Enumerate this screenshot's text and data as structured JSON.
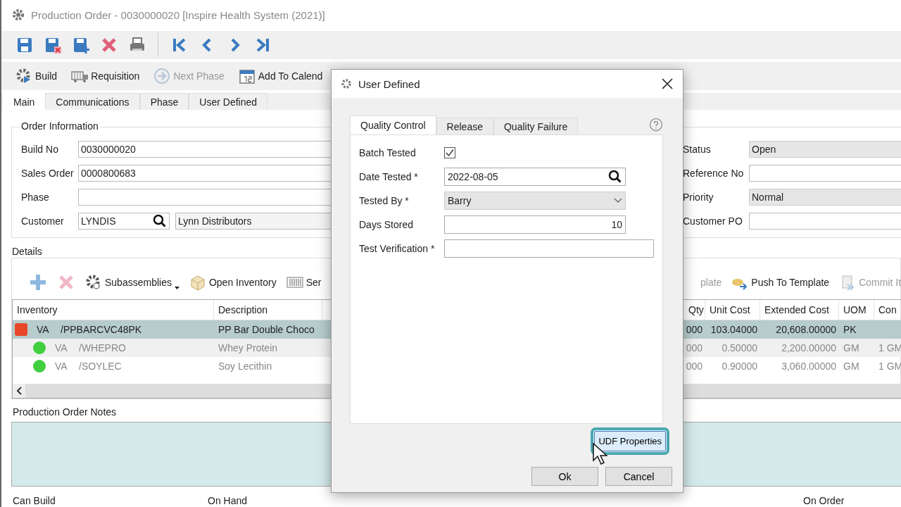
{
  "window": {
    "title": "Production Order - 0030000020 [Inspire Health System (2021)]"
  },
  "action_bar": [
    {
      "label": "Build",
      "disabled": false
    },
    {
      "label": "Requisition",
      "disabled": false
    },
    {
      "label": "Next Phase",
      "disabled": true
    },
    {
      "label": "Add To Calend",
      "disabled": false
    }
  ],
  "tabs": [
    {
      "label": "Main",
      "selected": true
    },
    {
      "label": "Communications",
      "selected": false
    },
    {
      "label": "Phase",
      "selected": false
    },
    {
      "label": "User Defined",
      "selected": false
    }
  ],
  "order_information": {
    "title": "Order Information",
    "left_fields": [
      {
        "kind": "text",
        "label": "Build No",
        "value": "0030000020"
      },
      {
        "kind": "text",
        "label": "Sales Order",
        "value": "0000800683"
      },
      {
        "kind": "text",
        "label": "Phase"
      },
      {
        "kind": "lookup",
        "label": "Customer",
        "value": "LYNDIS",
        "description": "Lynn Distributors"
      }
    ],
    "right_fields": [
      {
        "label": "Status",
        "value": "Open",
        "readonly": true
      },
      {
        "label": "Reference No",
        "readonly": false
      },
      {
        "label": "Priority",
        "value": "Normal",
        "readonly": true
      },
      {
        "label": "Customer PO",
        "readonly": false
      }
    ]
  },
  "details": {
    "title": "Details",
    "toolbar_left": [
      {
        "label": "Subassemblies",
        "disabled": false
      },
      {
        "label": "Open Inventory",
        "disabled": false
      },
      {
        "label": "Ser",
        "disabled": false
      }
    ],
    "toolbar_right": [
      {
        "label": "plate",
        "disabled": true
      },
      {
        "label": "Push To Template",
        "disabled": false
      },
      {
        "label": "Commit It",
        "disabled": true
      }
    ],
    "columns_left": [
      "Inventory",
      "Description"
    ],
    "columns_right": [
      "Qty",
      "Unit Cost",
      "Extended Cost",
      "UOM",
      "Con"
    ],
    "rows": [
      {
        "kind": "assembly",
        "selected": true,
        "location": "VA",
        "inventory": "/PPBARCVC48PK",
        "description": "PP Bar Double Choco",
        "qty": "000",
        "unit_cost": "103.04000",
        "extended_cost": "20,608.00000",
        "uom": "PK"
      },
      {
        "kind": "component",
        "selected": false,
        "location": "VA",
        "inventory": "/WHEPRO",
        "description": "Whey Protein",
        "qty": "000",
        "unit_cost": "0.50000",
        "extended_cost": "2,200.00000",
        "uom": "GM",
        "conv": "1 GM"
      },
      {
        "kind": "component",
        "selected": false,
        "location": "VA",
        "inventory": "/SOYLEC",
        "description": "Soy Lecithin",
        "qty": "000",
        "unit_cost": "0.90000",
        "extended_cost": "3,060.00000",
        "uom": "GM",
        "conv": "1 GM"
      }
    ]
  },
  "notes": {
    "label": "Production Order Notes"
  },
  "totals_left": [
    "Can Build",
    "On Hand"
  ],
  "totals_right": [
    "On Order"
  ],
  "dialog": {
    "title": "User Defined",
    "tabs": [
      {
        "label": "Quality Control",
        "selected": true
      },
      {
        "label": "Release",
        "selected": false
      },
      {
        "label": "Quality Failure",
        "selected": false
      }
    ],
    "fields": [
      {
        "kind": "checkbox",
        "label": "Batch Tested",
        "checked": true
      },
      {
        "kind": "lookup",
        "label": "Date Tested *",
        "value": "2022-08-05"
      },
      {
        "kind": "dropdown",
        "label": "Tested By *",
        "value": "Barry"
      },
      {
        "kind": "number",
        "label": "Days Stored",
        "value": "10"
      },
      {
        "kind": "wide_text",
        "label": "Test Verification *"
      }
    ],
    "udf_button": {
      "label": "UDF Properties",
      "focused": true
    },
    "buttons": [
      "Ok",
      "Cancel"
    ]
  }
}
